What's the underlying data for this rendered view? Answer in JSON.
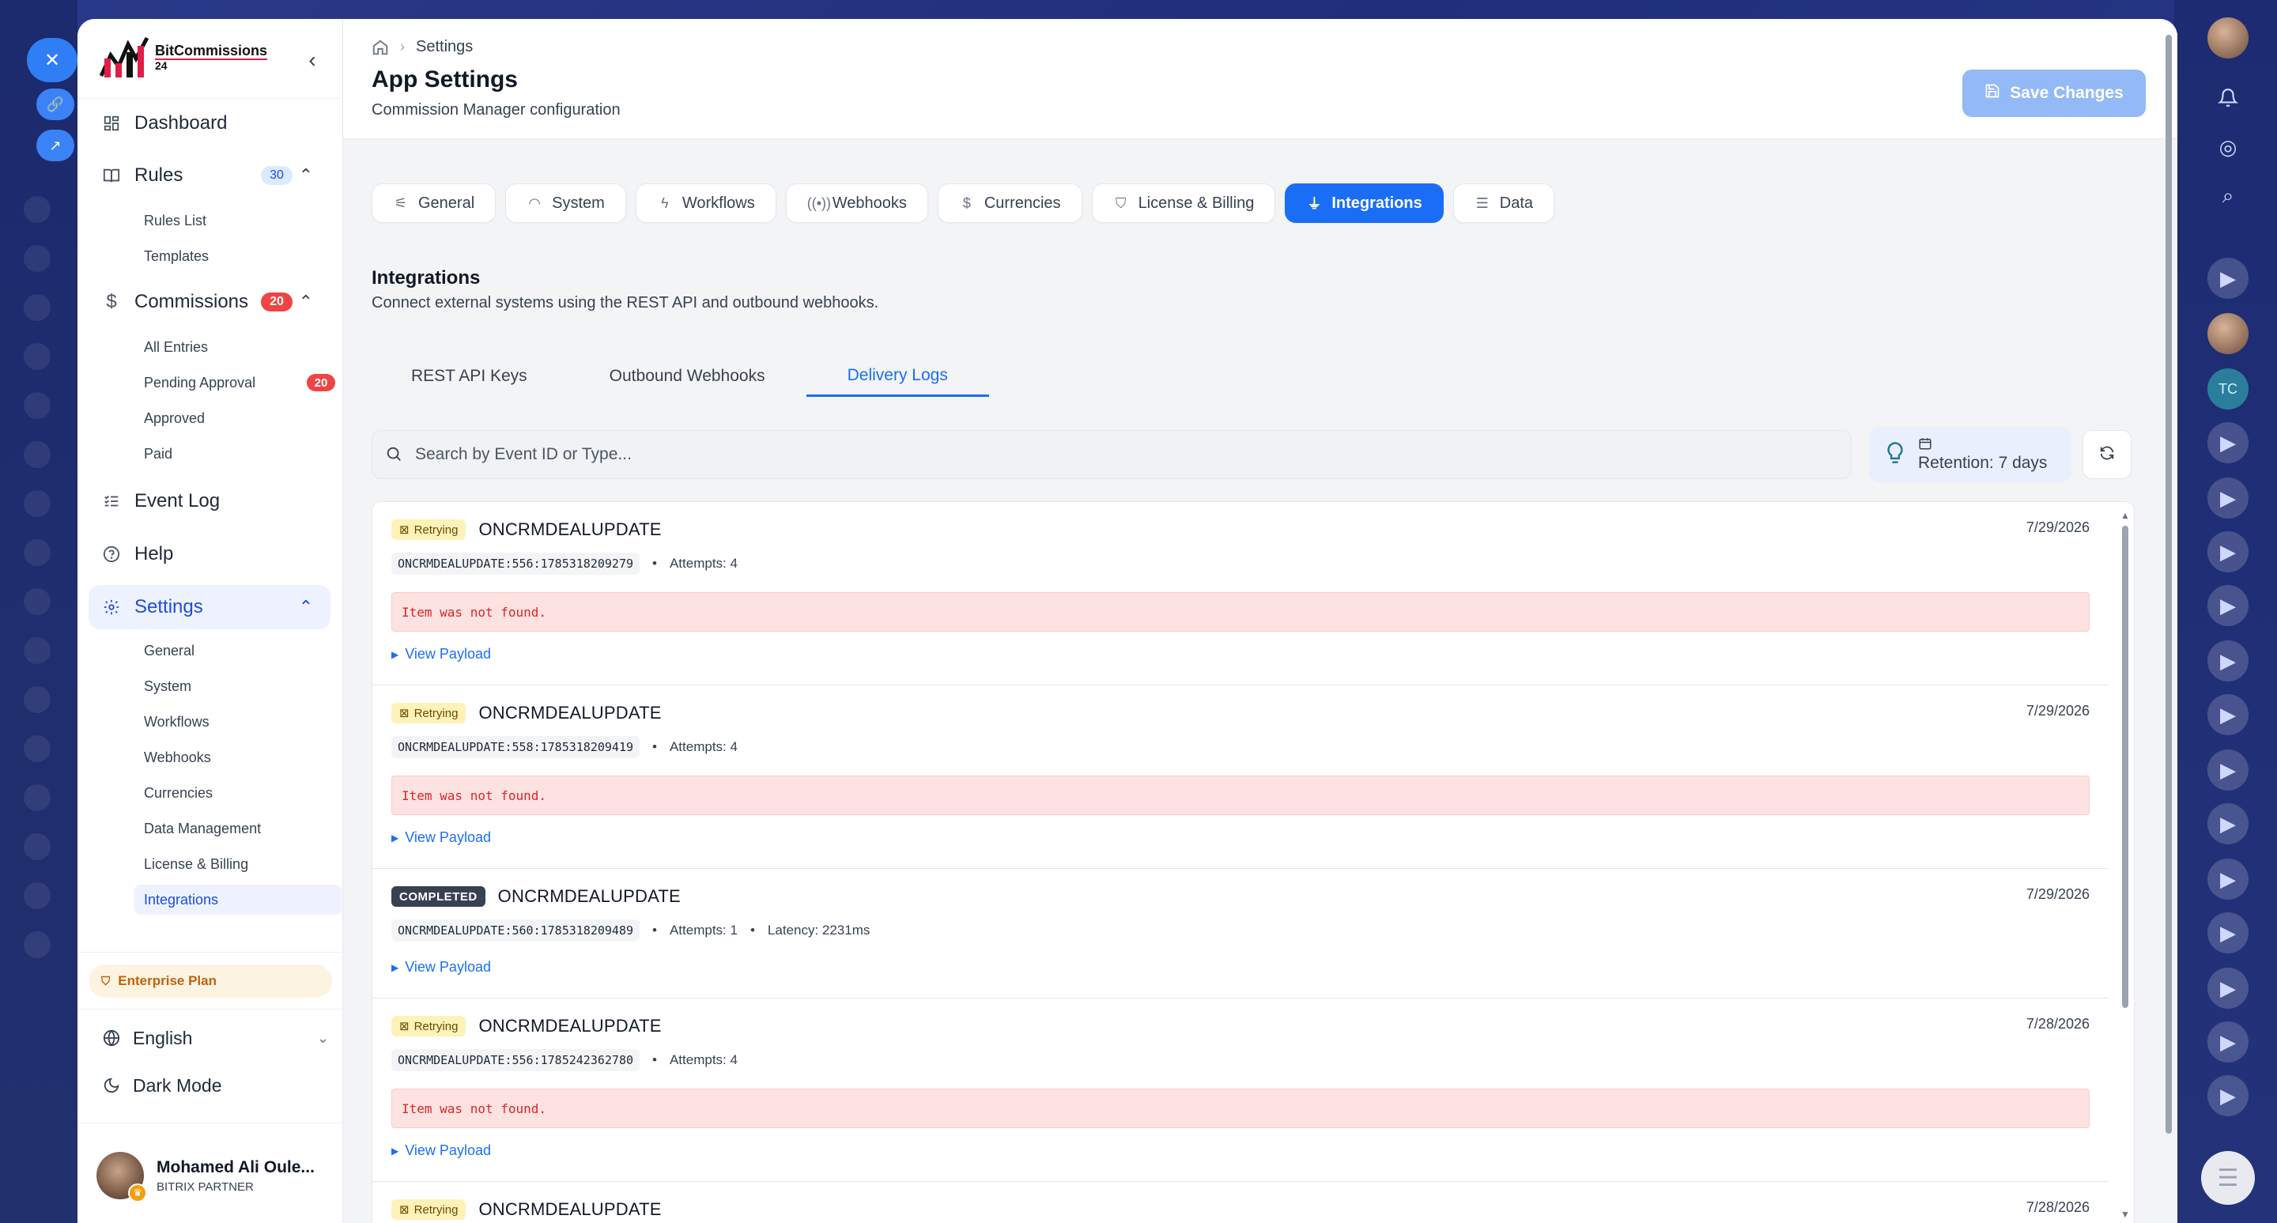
{
  "sidebar": {
    "logo": {
      "line1": "BitCommissions",
      "line2": "24"
    },
    "nav": {
      "dashboard": "Dashboard",
      "rules": "Rules",
      "rules_badge": "30",
      "rules_sub": [
        "Rules List",
        "Templates"
      ],
      "commissions": "Commissions",
      "commissions_badge": "20",
      "commissions_sub": [
        "All Entries",
        "Pending Approval",
        "Approved",
        "Paid"
      ],
      "pending_badge": "20",
      "event_log": "Event Log",
      "help": "Help",
      "settings": "Settings",
      "settings_sub": [
        "General",
        "System",
        "Workflows",
        "Webhooks",
        "Currencies",
        "Data Management",
        "License & Billing",
        "Integrations"
      ]
    },
    "plan": "Enterprise Plan",
    "language": "English",
    "dark_mode": "Dark Mode",
    "user": {
      "name": "Mohamed Ali Oule...",
      "role": "BITRIX PARTNER"
    }
  },
  "header": {
    "breadcrumb": "Settings",
    "title": "App Settings",
    "subtitle": "Commission Manager configuration",
    "save_label": "Save Changes"
  },
  "tabs": [
    "General",
    "System",
    "Workflows",
    "Webhooks",
    "Currencies",
    "License & Billing",
    "Integrations",
    "Data"
  ],
  "active_tab": "Integrations",
  "section": {
    "title": "Integrations",
    "subtitle": "Connect external systems using the REST API and outbound webhooks."
  },
  "subtabs": [
    "REST API Keys",
    "Outbound Webhooks",
    "Delivery Logs"
  ],
  "active_subtab": "Delivery Logs",
  "search": {
    "placeholder": "Search by Event ID or Type..."
  },
  "retention": "Retention: 7 days",
  "logs": [
    {
      "status": "Retrying",
      "type": "ONCRMDEALUPDATE",
      "date": "7/29/2026",
      "event_id": "ONCRMDEALUPDATE:556:1785318209279",
      "attempts": "Attempts: 4",
      "latency": "",
      "error": "Item was not found.",
      "payload": "View Payload"
    },
    {
      "status": "Retrying",
      "type": "ONCRMDEALUPDATE",
      "date": "7/29/2026",
      "event_id": "ONCRMDEALUPDATE:558:1785318209419",
      "attempts": "Attempts: 4",
      "latency": "",
      "error": "Item was not found.",
      "payload": "View Payload"
    },
    {
      "status": "COMPLETED",
      "type": "ONCRMDEALUPDATE",
      "date": "7/29/2026",
      "event_id": "ONCRMDEALUPDATE:560:1785318209489",
      "attempts": "Attempts: 1",
      "latency": "Latency: 2231ms",
      "error": "",
      "payload": "View Payload"
    },
    {
      "status": "Retrying",
      "type": "ONCRMDEALUPDATE",
      "date": "7/28/2026",
      "event_id": "ONCRMDEALUPDATE:556:1785242362780",
      "attempts": "Attempts: 4",
      "latency": "",
      "error": "Item was not found.",
      "payload": "View Payload"
    },
    {
      "status": "Retrying",
      "type": "ONCRMDEALUPDATE",
      "date": "7/28/2026",
      "event_id": "",
      "attempts": "",
      "latency": "",
      "error": "",
      "payload": ""
    }
  ],
  "colors": {
    "accent": "#1a6ef5",
    "retry_bg": "#fdf2b8",
    "error_bg": "#fde2e2",
    "error_text": "#dc2626",
    "plan_bg": "#fdf3e1",
    "plan_text": "#c2620a"
  }
}
